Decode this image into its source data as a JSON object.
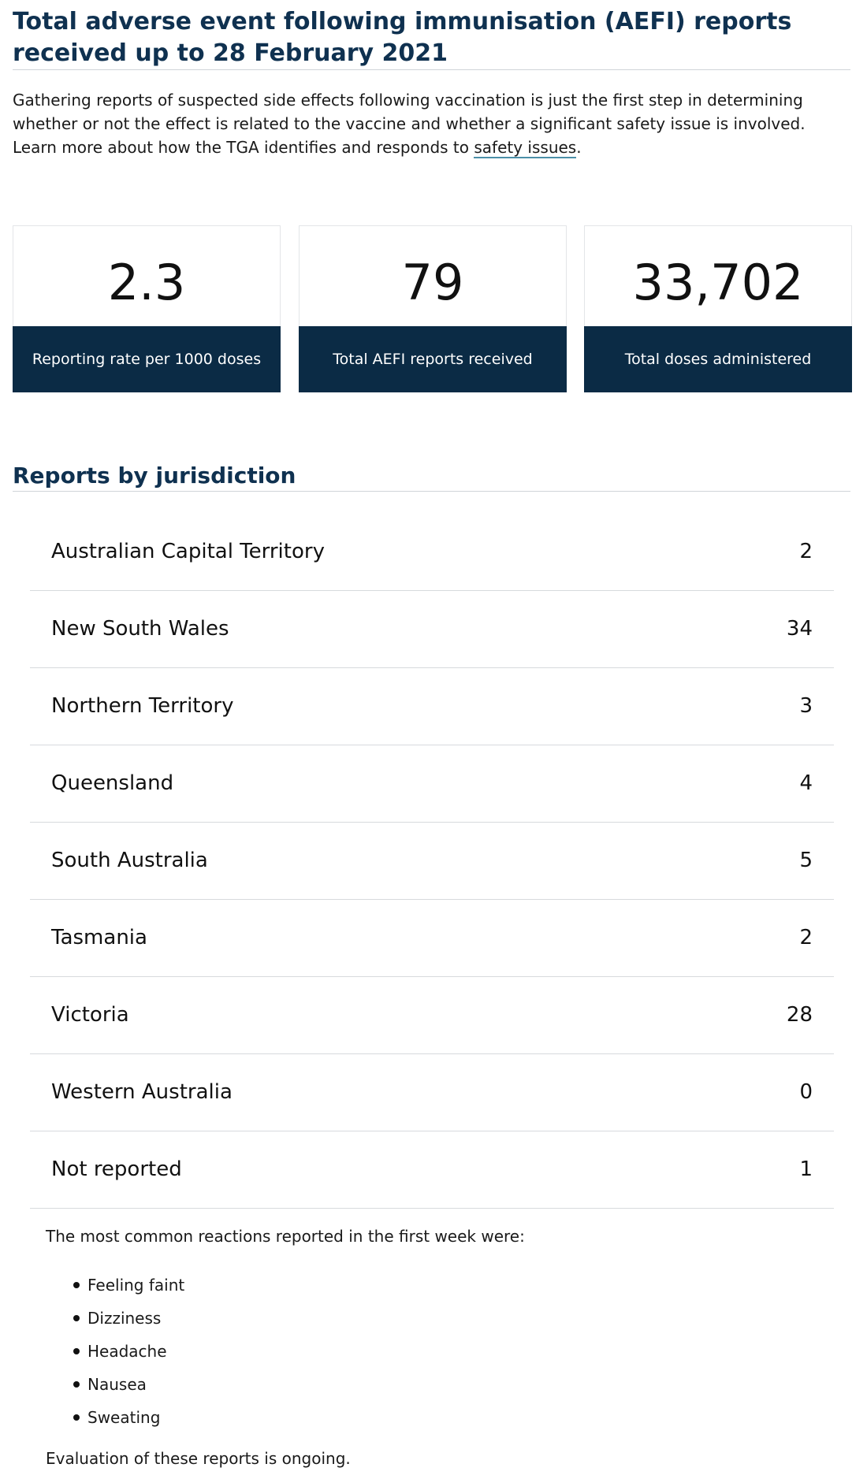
{
  "header": {
    "title": "Total adverse event following immunisation (AEFI) reports received up to 28 February 2021"
  },
  "intro": {
    "text_before_link": "Gathering reports of suspected side effects following vaccination is just the first step in determining whether or not the effect is related to the vaccine and whether a significant safety issue is involved. Learn more about how the TGA identifies and responds to ",
    "link_text": "safety issues",
    "text_after_link": "."
  },
  "stats": [
    {
      "value": "2.3",
      "label": "Reporting rate per 1000 doses"
    },
    {
      "value": "79",
      "label": "Total AEFI reports received"
    },
    {
      "value": "33,702",
      "label": "Total doses administered"
    }
  ],
  "jurisdictions": {
    "title": "Reports by jurisdiction",
    "rows": [
      {
        "name": "Australian Capital Territory",
        "count": "2"
      },
      {
        "name": "New South Wales",
        "count": "34"
      },
      {
        "name": "Northern Territory",
        "count": "3"
      },
      {
        "name": "Queensland",
        "count": "4"
      },
      {
        "name": "South Australia",
        "count": "5"
      },
      {
        "name": "Tasmania",
        "count": "2"
      },
      {
        "name": "Victoria",
        "count": "28"
      },
      {
        "name": "Western Australia",
        "count": "0"
      },
      {
        "name": "Not reported",
        "count": "1"
      }
    ]
  },
  "reactions": {
    "intro": "The most common reactions reported in the first week were:",
    "items": [
      "Feeling faint",
      "Dizziness",
      "Headache",
      "Nausea",
      "Sweating"
    ],
    "closing": "Evaluation of these reports is ongoing."
  },
  "colors": {
    "heading": "#0f3150",
    "card_label_bg": "#0b2b45",
    "link_underline": "#4b8fa8"
  }
}
